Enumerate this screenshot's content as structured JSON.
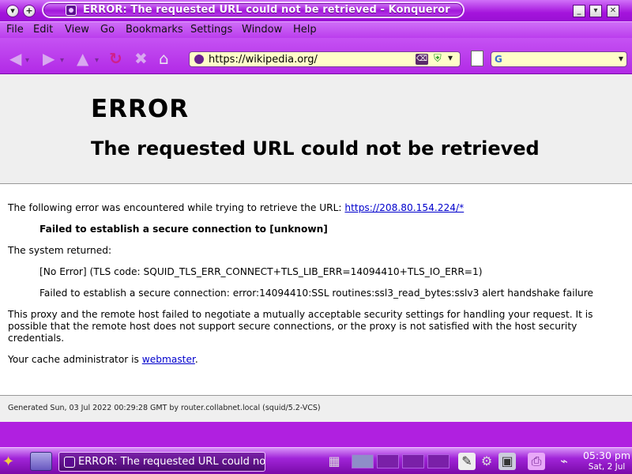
{
  "window": {
    "title": "ERROR: The requested URL could not be retrieved - Konqueror"
  },
  "menu": {
    "items": [
      "File",
      "Edit",
      "View",
      "Go",
      "Bookmarks",
      "Settings",
      "Window",
      "Help"
    ]
  },
  "toolbar": {
    "url": "https://wikipedia.org/",
    "search_engine_icon": "google-icon"
  },
  "page": {
    "heading": "ERROR",
    "subheading": "The requested URL could not be retrieved",
    "intro": "The following error was encountered while trying to retrieve the URL:",
    "error_url": "https://208.80.154.224/*",
    "failed": "Failed to establish a secure connection to [unknown]",
    "system_returned": "The system returned:",
    "tls_code": "[No Error] (TLS code: SQUID_TLS_ERR_CONNECT+TLS_LIB_ERR=14094410+TLS_IO_ERR=1)",
    "ssl_error": "Failed to establish a secure connection: error:14094410:SSL routines:ssl3_read_bytes:sslv3 alert handshake failure",
    "explanation": "This proxy and the remote host failed to negotiate a mutually acceptable security settings for handling your request. It is possible that the remote host does not support secure connections, or the proxy is not satisfied with the host security credentials.",
    "admin_prefix": "Your cache administrator is",
    "admin_link": "webmaster",
    "admin_suffix": ".",
    "footer": "Generated Sun, 03 Jul 2022 00:29:28 GMT by router.collabnet.local (squid/5.2-VCS)"
  },
  "taskbar": {
    "task_title": "ERROR: The requested URL could not be retrieved - Konqueror",
    "time": "05:30 pm",
    "date": "Sat, 2 Jul"
  },
  "colors": {
    "accent": "#b020e0",
    "link": "#0000cc",
    "url_bg": "#fffdc8"
  }
}
